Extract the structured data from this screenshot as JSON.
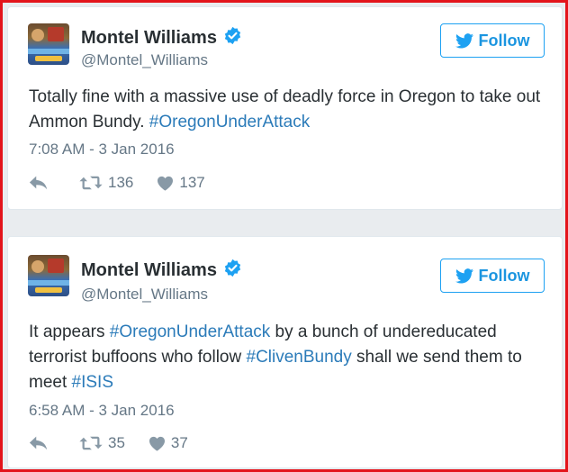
{
  "tweets": [
    {
      "author_name": "Montel Williams",
      "handle": "@Montel_Williams",
      "follow_label": "Follow",
      "text_parts": [
        {
          "text": "Totally fine with a massive use of deadly force in Oregon to take out Ammon Bundy. ",
          "hashtag": false
        },
        {
          "text": "#OregonUnderAttack",
          "hashtag": true
        }
      ],
      "timestamp": "7:08 AM - 3 Jan 2016",
      "retweets": "136",
      "likes": "137"
    },
    {
      "author_name": "Montel Williams",
      "handle": "@Montel_Williams",
      "follow_label": "Follow",
      "text_parts": [
        {
          "text": "It appears ",
          "hashtag": false
        },
        {
          "text": "#OregonUnderAttack",
          "hashtag": true
        },
        {
          "text": " by a bunch of undereducated terrorist buffoons who follow ",
          "hashtag": false
        },
        {
          "text": "#ClivenBundy",
          "hashtag": true
        },
        {
          "text": " shall we send them to meet ",
          "hashtag": false
        },
        {
          "text": "#ISIS",
          "hashtag": true
        }
      ],
      "timestamp": "6:58 AM - 3 Jan 2016",
      "retweets": "35",
      "likes": "37"
    }
  ],
  "colors": {
    "frame_border": "#e3141b",
    "twitter_blue": "#1da1f2",
    "hashtag": "#2b7bb9",
    "verified": "#1da1f2",
    "text": "#292f33",
    "muted": "#657786"
  },
  "icons": [
    "verified-badge-icon",
    "twitter-bird-icon",
    "reply-icon",
    "retweet-icon",
    "heart-icon"
  ]
}
